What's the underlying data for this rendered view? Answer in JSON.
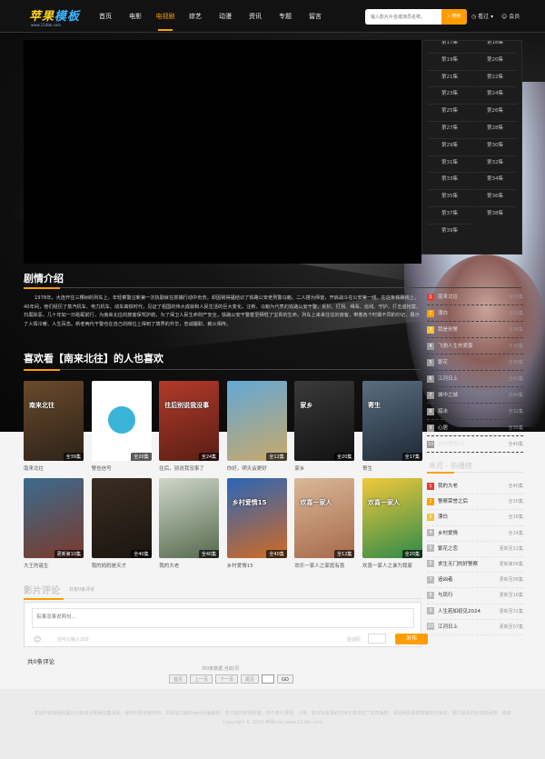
{
  "header": {
    "logo_main": "苹果",
    "logo_accent": "模板",
    "logo_sub": "www.11dbk.com",
    "nav": [
      "首页",
      "电影",
      "电视剧",
      "综艺",
      "动漫",
      "资讯",
      "专题",
      "留言"
    ],
    "nav_active": 2,
    "search_placeholder": "输入影片片名或演员名称。",
    "search_button": "搜索",
    "history_label": "看过",
    "member_label": "会员"
  },
  "episodes": [
    "第17集",
    "第18集",
    "第19集",
    "第20集",
    "第21集",
    "第22集",
    "第23集",
    "第24集",
    "第25集",
    "第26集",
    "第27集",
    "第28集",
    "第29集",
    "第30集",
    "第31集",
    "第32集",
    "第33集",
    "第34集",
    "第35集",
    "第36集",
    "第37集",
    "第38集",
    "第39集"
  ],
  "intro": {
    "title": "剧情介绍",
    "text": "1978年，大连开往三棵树的列车上，年轻乘警汪新第一次执勤就在抓捕行动中负伤，却因祸得福结识了铁路公安老刑警马魁。二人搭为师徒，开启战斗在公安第一线。在这条铁路线上，40年间，他们经历了蒸汽机车、电力机车、动车高铁时代，见证了祖国的伟大成就和人民生活的巨大变化。汪新、马魁为代表的铁路公安干警，反扒、打拐、缉毒、巡线、守护，打击盗抢案，扫黑除恶，几十年如一日砥砺前行，为南来北往的旅客保驾护航，为了保卫人民生命财产安全，铁路公安干警甚至牺牲了宝贵的生命。列车上来来往往的旅客，带着各个时期不同的印记，展示了人情冷暖、人生百态。新老两代干警也在自己的岗位上得到了境界的升华，忠诚履职、薪火相传。"
  },
  "also_like": {
    "title": "喜欢看【南来北往】的人也喜欢",
    "row1": [
      {
        "name": "南来北往",
        "badge": "全39集",
        "poster_text": "南来北往",
        "c1": "#6a4a2b",
        "c2": "#2d2219"
      },
      {
        "name": "警告信号",
        "badge": "全20集",
        "poster_text": "",
        "c1": "#ffffff",
        "c2": "#ffffff"
      },
      {
        "name": "往后，别说我没事了",
        "badge": "全24集",
        "poster_text": "往后别说我没事",
        "c1": "#b23a2a",
        "c2": "#5a1e14"
      },
      {
        "name": "你好，明天会更好",
        "badge": "全12集",
        "poster_text": "",
        "c1": "#62a8d6",
        "c2": "#c9a86a"
      },
      {
        "name": "家乡",
        "badge": "全20集",
        "poster_text": "家乡",
        "c1": "#3a3a3a",
        "c2": "#111111"
      },
      {
        "name": "寄生",
        "badge": "全17集",
        "poster_text": "寄生",
        "c1": "#5a6d80",
        "c2": "#1e2a36"
      }
    ],
    "row2": [
      {
        "name": "大王的诞生",
        "badge": "更新第10集",
        "poster_text": "",
        "c1": "#3b6b8f",
        "c2": "#7a3a2a"
      },
      {
        "name": "我的妈妈是天才",
        "badge": "全40集",
        "poster_text": "",
        "c1": "#3a2e22",
        "c2": "#1a1410"
      },
      {
        "name": "我的大老",
        "badge": "全40集",
        "poster_text": "",
        "c1": "#cfd6c8",
        "c2": "#546a4e"
      },
      {
        "name": "乡村爱情15",
        "badge": "全40集",
        "poster_text": "乡村爱情15",
        "c1": "#2a66b8",
        "c2": "#d26a23"
      },
      {
        "name": "欢乐一家人之家庭有喜",
        "badge": "全12集",
        "poster_text": "欢喜一家人",
        "c1": "#d9b898",
        "c2": "#a66a4a"
      },
      {
        "name": "欢喜一家人之谁为我家",
        "badge": "全20集",
        "poster_text": "欢喜一家人",
        "c1": "#f2c93a",
        "c2": "#2e8a4a"
      }
    ]
  },
  "hot_rank_dark": [
    {
      "name": "南来北往",
      "status": "全39集"
    },
    {
      "name": "漂白",
      "status": "全30集"
    },
    {
      "name": "我是刑警",
      "status": "全38集"
    },
    {
      "name": "飞驰人生热爱篇",
      "status": "全30集"
    },
    {
      "name": "繁花",
      "status": "全30集"
    },
    {
      "name": "江河日上",
      "status": "全40集"
    },
    {
      "name": "城中之城",
      "status": "全40集"
    },
    {
      "name": "猎冰",
      "status": "全32集"
    },
    {
      "name": "心居",
      "status": "全35集"
    },
    {
      "name": "乡村爱情16",
      "status": "全40集"
    }
  ],
  "hot_rank_light": {
    "title": "本月 - 热播榜",
    "items": [
      {
        "name": "我的大老",
        "status": "全40集"
      },
      {
        "name": "警察荣誉之后",
        "status": "全20集"
      },
      {
        "name": "漂白",
        "status": "全18集"
      },
      {
        "name": "乡村爱情",
        "status": "全24集"
      },
      {
        "name": "繁花之恋",
        "status": "更新至22集"
      },
      {
        "name": "求生无门的好警察",
        "status": "更新第06集"
      },
      {
        "name": "追凶者",
        "status": "更新至08集"
      },
      {
        "name": "与凤行",
        "status": "更新至16集"
      },
      {
        "name": "人生若如初见2024",
        "status": "更新至31集"
      },
      {
        "name": "江河日上",
        "status": "更新至07集"
      }
    ]
  },
  "comments": {
    "title": "影片评论",
    "count_text": "共有0条评论",
    "placeholder": "有事没事说两句...",
    "verify_hint": "还可以输入200",
    "verify_label": "验证码",
    "submit": "发布",
    "total_label": "共0条评论",
    "page_info": "共0条数据,当前/页",
    "pager": [
      "首页",
      "上一页",
      "下一页",
      "尾页",
      "GO"
    ]
  },
  "footer": {
    "line1": "本站所有视频和图片均来自互联网收集而来，版权归原创者所有，本网站只提供web页面服务，并不提供资源存储，也不参与录制、上传。若本站收录的节目无意侵犯了贵司版权，请给网页底部邮箱地址来信，我们会及时处理和回复，谢谢",
    "line2": "Copyright © 2014 苹果cms www.11dbk.com"
  },
  "colors": {
    "accent": "#ff9d00",
    "bg_dark": "#0b0b0b",
    "page_bg": "#f4f4f4"
  }
}
